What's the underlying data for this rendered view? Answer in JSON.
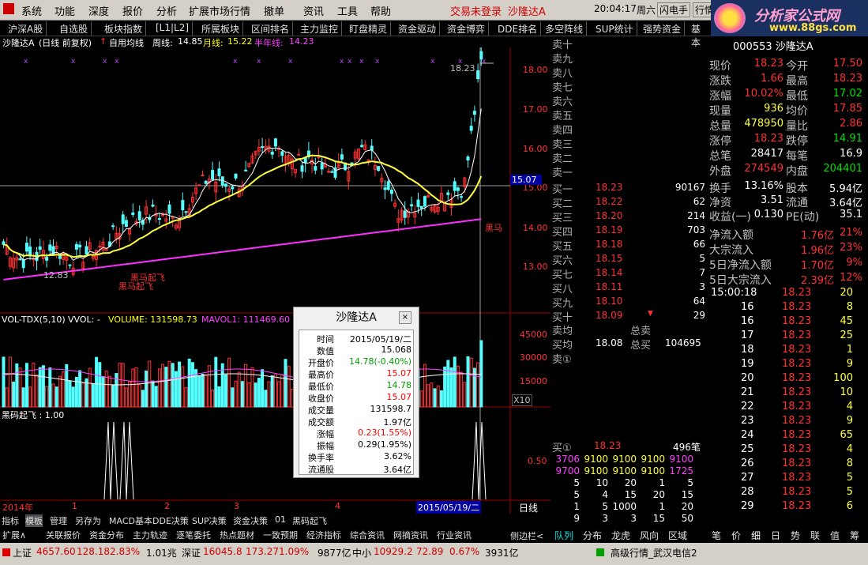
{
  "menubar": {
    "items": [
      "系统",
      "功能",
      "深度",
      "报价",
      "分析",
      "扩展市场行情",
      "撤单",
      "资讯",
      "工具",
      "帮助"
    ],
    "login": "交易未登录",
    "stock": "沙隆达A",
    "time": "20:04:17",
    "weekday": "周六",
    "flash": "闪电手",
    "quote": "行情"
  },
  "logo": {
    "title": "分析家公式网",
    "url": "www.88gs.com"
  },
  "tabs": [
    "沪深A股",
    "自选股",
    "板块指数",
    "[L1|L2]",
    "所属板块",
    "区间排名",
    "主力监控",
    "盯盘精灵",
    "资金驱动",
    "资金博弈",
    "DDE排名",
    "多空阵线",
    "SUP统计",
    "强势资金",
    "基本"
  ],
  "chart_info": {
    "name": "沙隆达A",
    "period": "(日线 前复权)",
    "ma_label": "自用均线",
    "week_label": "周线:",
    "week_val": "14.85",
    "month_label": "月线:",
    "month_val": "15.22",
    "half_label": "半年线:",
    "half_val": "14.23"
  },
  "price_axis": [
    "18.00",
    "17.00",
    "16.00",
    "15.00",
    "14.00",
    "13.00"
  ],
  "price_labels": {
    "high": "18.23",
    "low": "12.83",
    "cursor": "15.07",
    "marker1": "黑马起飞",
    "marker2": "黑马起飞",
    "marker3": "黑马"
  },
  "vol_info": {
    "label": "VOL-TDX(5,10)",
    "vvol": "VVOL: -",
    "volume": "VOLUME: 131598.73",
    "mavol": "MAVOL1: 111469.60"
  },
  "vol_axis": [
    "45000",
    "30000",
    "15000"
  ],
  "vol_unit": "X10",
  "ind_info": {
    "label": "黑码起飞 : 1.00"
  },
  "ind_axis": "0.50",
  "date_axis": [
    "2014年",
    "1",
    "2",
    "3",
    "4"
  ],
  "date_cursor": "2015/05/19/二",
  "period_btn": "日线",
  "popup": {
    "title": "沙隆达A",
    "close": "×",
    "rows": [
      {
        "k": "时间",
        "v": "2015/05/19/二",
        "c": "#000"
      },
      {
        "k": "数值",
        "v": "15.068",
        "c": "#000"
      },
      {
        "k": "开盘价",
        "v": "14.78(-0.40%)",
        "c": "#00a000"
      },
      {
        "k": "最高价",
        "v": "15.07",
        "c": "#ff0000"
      },
      {
        "k": "最低价",
        "v": "14.78",
        "c": "#00a000"
      },
      {
        "k": "收盘价",
        "v": "15.07",
        "c": "#ff0000"
      },
      {
        "k": "成交量",
        "v": "131598.7",
        "c": "#000"
      },
      {
        "k": "成交额",
        "v": "1.97亿",
        "c": "#000"
      },
      {
        "k": "涨幅",
        "v": "0.23(1.55%)",
        "c": "#ff0000"
      },
      {
        "k": "振幅",
        "v": "0.29(1.95%)",
        "c": "#000"
      },
      {
        "k": "换手率",
        "v": "3.62%",
        "c": "#000"
      },
      {
        "k": "流通股",
        "v": "3.64亿",
        "c": "#000"
      }
    ]
  },
  "sell_levels": [
    "卖十",
    "卖九",
    "卖八",
    "卖七",
    "卖六",
    "卖五",
    "卖四",
    "卖三",
    "卖二",
    "卖一"
  ],
  "buy_levels": [
    {
      "l": "买一",
      "p": "18.23",
      "v": "90167"
    },
    {
      "l": "买二",
      "p": "18.22",
      "v": "62"
    },
    {
      "l": "买三",
      "p": "18.20",
      "v": "214"
    },
    {
      "l": "买四",
      "p": "18.19",
      "v": "703"
    },
    {
      "l": "买五",
      "p": "18.18",
      "v": "66"
    },
    {
      "l": "买六",
      "p": "18.15",
      "v": "5"
    },
    {
      "l": "买七",
      "p": "18.14",
      "v": "7"
    },
    {
      "l": "买八",
      "p": "18.11",
      "v": "3"
    },
    {
      "l": "买九",
      "p": "18.10",
      "v": "64"
    },
    {
      "l": "买十",
      "p": "18.09",
      "v": "29"
    }
  ],
  "avg": {
    "sell_avg": "卖均",
    "total_sell": "总卖",
    "buy_avg": "买均",
    "buy_avg_val": "18.08",
    "total_buy": "总买",
    "total_buy_val": "104695",
    "sell1": "卖①"
  },
  "buy1": {
    "label": "买①",
    "price": "18.23",
    "count": "496笔"
  },
  "queue": [
    [
      "3706",
      "9100",
      "9100",
      "9100",
      "9100"
    ],
    [
      "9700",
      "9100",
      "9100",
      "9100",
      "1725"
    ],
    [
      "5",
      "10",
      "20",
      "1",
      "5"
    ],
    [
      "5",
      "4",
      "15",
      "20",
      "15"
    ],
    [
      "1",
      "5",
      "1000",
      "1",
      "20"
    ],
    [
      "9",
      "3",
      "3",
      "15",
      "50"
    ]
  ],
  "stock_code": "000553 沙隆达A",
  "quote": [
    {
      "a": "现价",
      "av": "18.23",
      "b": "今开",
      "bv": "17.50"
    },
    {
      "a": "涨跌",
      "av": "1.66",
      "b": "最高",
      "bv": "18.23"
    },
    {
      "a": "涨幅",
      "av": "10.02%",
      "b": "最低",
      "bv": "17.02"
    },
    {
      "a": "现量",
      "av": "936",
      "b": "均价",
      "bv": "17.85"
    },
    {
      "a": "总量",
      "av": "478950",
      "b": "量比",
      "bv": "2.86"
    },
    {
      "a": "涨停",
      "av": "18.23",
      "b": "跌停",
      "bv": "14.91"
    },
    {
      "a": "总笔",
      "av": "28417",
      "b": "每笔",
      "bv": "16.9"
    },
    {
      "a": "外盘",
      "av": "274549",
      "b": "内盘",
      "bv": "204401"
    }
  ],
  "turnover": [
    {
      "a": "换手",
      "av": "13.16%",
      "b": "股本",
      "bv": "5.94亿"
    },
    {
      "a": "净资",
      "av": "3.51",
      "b": "流通",
      "bv": "3.64亿"
    },
    {
      "a": "收益(一)",
      "av": "0.130",
      "b": "PE(动)",
      "bv": "35.1"
    }
  ],
  "flows": [
    {
      "k": "净流入额",
      "v": "1.76亿",
      "p": "21%"
    },
    {
      "k": "大宗流入",
      "v": "1.96亿",
      "p": "23%"
    },
    {
      "k": "5日净流入额",
      "v": "1.70亿",
      "p": "9%"
    },
    {
      "k": "5日大宗流入",
      "v": "2.39亿",
      "p": "12%"
    }
  ],
  "ticks": [
    {
      "t": "15:00:18",
      "p": "18.23",
      "v": "20"
    },
    {
      "t": "16",
      "p": "18.23",
      "v": "8"
    },
    {
      "t": "16",
      "p": "18.23",
      "v": "45"
    },
    {
      "t": "17",
      "p": "18.23",
      "v": "25"
    },
    {
      "t": "18",
      "p": "18.23",
      "v": "1"
    },
    {
      "t": "19",
      "p": "18.23",
      "v": "9"
    },
    {
      "t": "20",
      "p": "18.23",
      "v": "100"
    },
    {
      "t": "21",
      "p": "18.23",
      "v": "10"
    },
    {
      "t": "22",
      "p": "18.23",
      "v": "4"
    },
    {
      "t": "23",
      "p": "18.23",
      "v": "9"
    },
    {
      "t": "24",
      "p": "18.23",
      "v": "65"
    },
    {
      "t": "25",
      "p": "18.23",
      "v": "4"
    },
    {
      "t": "26",
      "p": "18.23",
      "v": "8"
    },
    {
      "t": "27",
      "p": "18.23",
      "v": "5"
    },
    {
      "t": "28",
      "p": "18.23",
      "v": "5"
    },
    {
      "t": "29",
      "p": "18.23",
      "v": "6"
    }
  ],
  "bottom_tabs": [
    "指标",
    "模板",
    "管理",
    "另存为",
    "MACD基本",
    "DDE决策",
    "SUP决策",
    "资金决策",
    "01",
    "黑码起飞"
  ],
  "bottom_tabs2": [
    "扩展∧",
    "关联报价",
    "资金分布",
    "主力轨迹",
    "逐笔委托",
    "热点题材",
    "一致预期",
    "经济指标",
    "综合资讯",
    "网摘资讯",
    "行业资讯"
  ],
  "side_tab": "侧边栏<",
  "mid_tabs": [
    "队列",
    "分布",
    "龙虎",
    "风向",
    "区域"
  ],
  "right_tabs": [
    "笔",
    "价",
    "细",
    "日",
    "势",
    "联",
    "值",
    "筹"
  ],
  "status": {
    "sh": "上证",
    "sh_val": "4657.60",
    "sh_chg": "128.18",
    "sh_pct": "2.83%",
    "sh_amt": "1.01兆",
    "sz": "深证",
    "sz_val": "16045.8",
    "sz_chg": "173.27",
    "sz_pct": "1.09%",
    "sz_amt": "9877亿",
    "zx": "中小",
    "zx_val": "10929.2",
    "zx_chg": "72.89",
    "zx_pct": "0.67%",
    "zx_amt": "3931亿",
    "server": "高级行情_武汉电信2"
  },
  "chart_data": {
    "type": "candlestick",
    "title": "沙隆达A",
    "ylim": [
      12.5,
      18.5
    ],
    "high": 18.23,
    "low": 12.83
  }
}
